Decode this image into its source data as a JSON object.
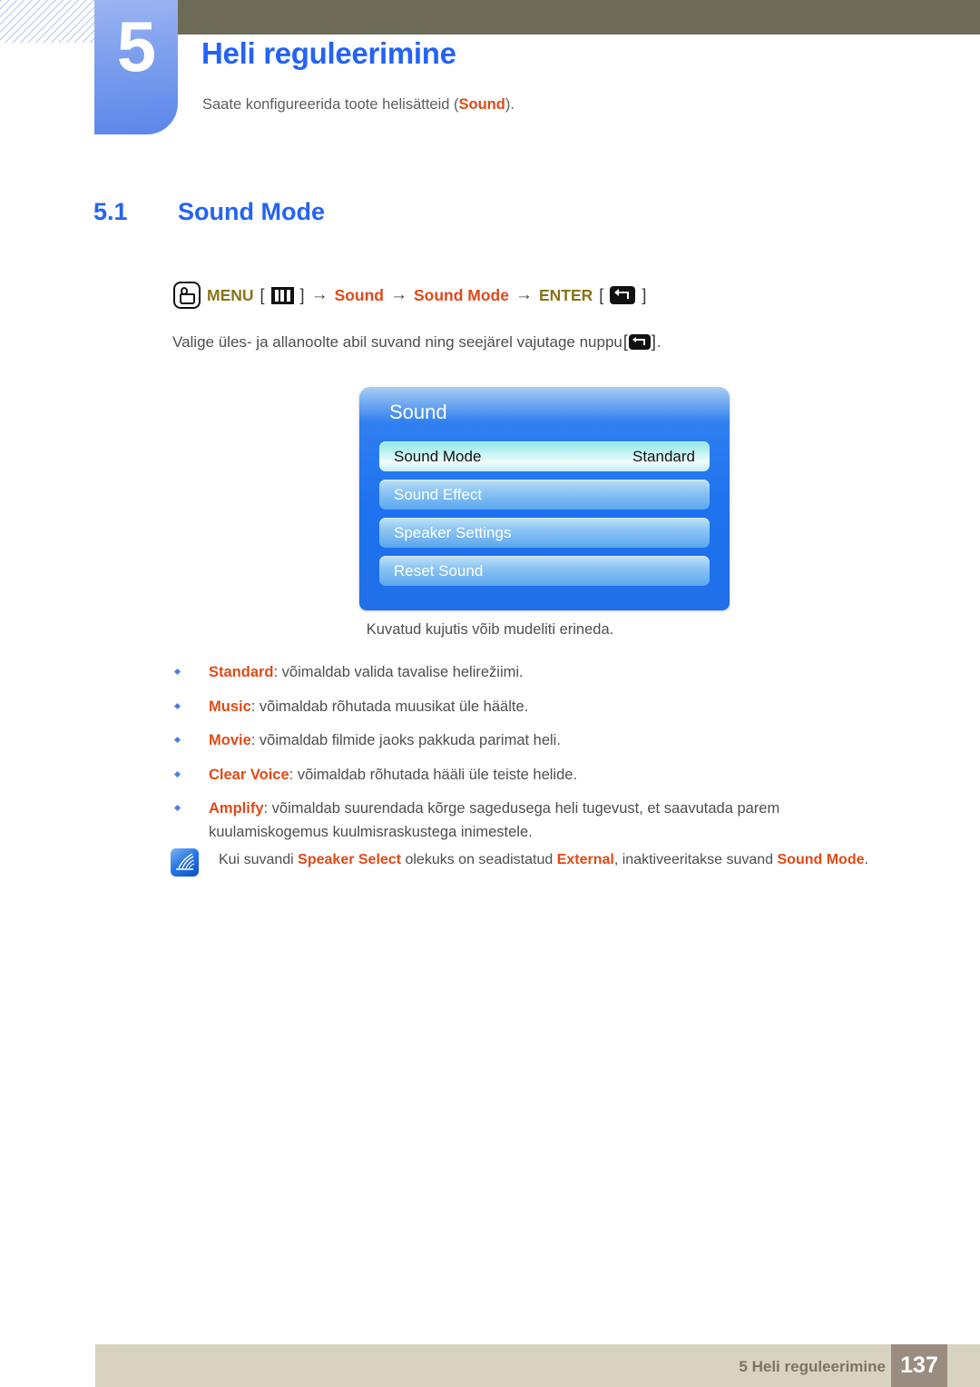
{
  "chapter": {
    "number": "5",
    "title": "Heli reguleerimine",
    "subtitle_before": "Saate konfigureerida toote helisätteid (",
    "subtitle_keyword": "Sound",
    "subtitle_after": ")."
  },
  "section": {
    "number": "5.1",
    "title": "Sound Mode"
  },
  "menu_path": {
    "hand_icon": "hand-pointer-icon",
    "menu_label": "MENU",
    "menu_icon": "menu-bars-icon",
    "bracket_open": "[",
    "bracket_close": "]",
    "arrow": "→",
    "step_sound": "Sound",
    "step_sound_mode": "Sound Mode",
    "enter_label": "ENTER",
    "enter_icon": "enter-key-icon"
  },
  "instruction": {
    "text_before": "Valige üles- ja allanoolte abil suvand ning seejärel vajutage nuppu ",
    "bracket_open": "[",
    "bracket_close": "]",
    "text_after": "."
  },
  "osd": {
    "title": "Sound",
    "rows": [
      {
        "label": "Sound Mode",
        "value": "Standard",
        "selected": true
      },
      {
        "label": "Sound Effect",
        "value": "",
        "selected": false
      },
      {
        "label": "Speaker Settings",
        "value": "",
        "selected": false
      },
      {
        "label": "Reset Sound",
        "value": "",
        "selected": false
      }
    ]
  },
  "caption": "Kuvatud kujutis võib mudeliti erineda.",
  "bullets": [
    {
      "term": "Standard",
      "text": ": võimaldab valida tavalise helirežiimi."
    },
    {
      "term": "Music",
      "text": ": võimaldab rõhutada muusikat üle häälte."
    },
    {
      "term": "Movie",
      "text": ": võimaldab filmide jaoks pakkuda parimat heli."
    },
    {
      "term": "Clear Voice",
      "text": ": võimaldab rõhutada hääli üle teiste helide."
    },
    {
      "term": "Amplify",
      "text": ": võimaldab suurendada kõrge sagedusega heli tugevust, et saavutada parem kuulamiskogemus kuulmisraskustega inimestele."
    }
  ],
  "note": {
    "icon": "note-pen-icon",
    "part1": "Kui suvandi ",
    "kw1": "Speaker Select",
    "part2": " olekuks on seadistatud ",
    "kw2": "External",
    "part3": ", inaktiveeritakse suvand ",
    "kw3": "Sound Mode",
    "part4": "."
  },
  "footer": {
    "label": "5 Heli reguleerimine",
    "page": "137"
  },
  "colors": {
    "accent_blue": "#2463f5",
    "keyword_orange": "#e04a18",
    "keyword_olive": "#8a7318",
    "olive_bar": "#6d6b57",
    "footer_bar": "#d8d2c0",
    "footer_page_box": "#9a8d80",
    "osd_blue": "#1e72ef"
  }
}
